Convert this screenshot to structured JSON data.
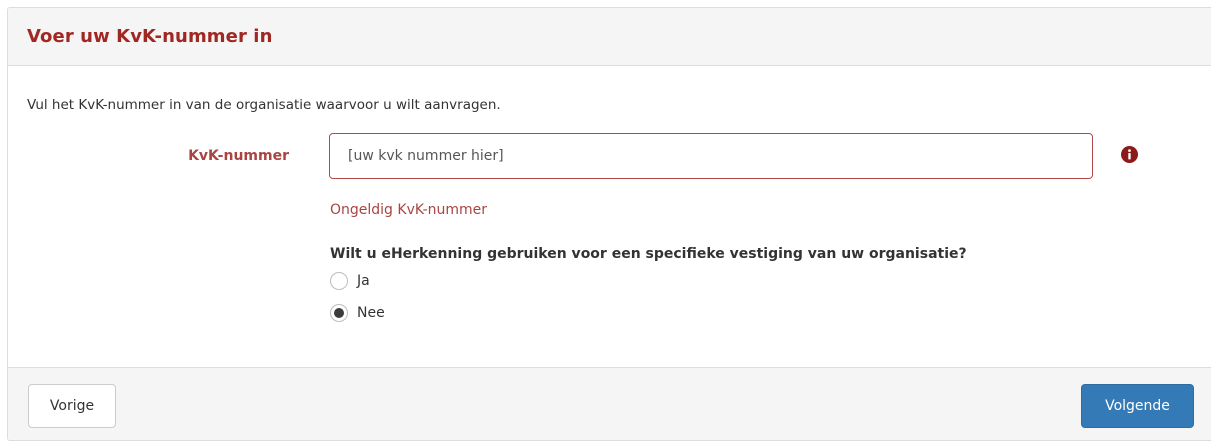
{
  "panel": {
    "title": "Voer uw KvK-nummer in"
  },
  "form": {
    "intro": "Vul het KvK-nummer in van de organisatie waarvoor u wilt aanvragen.",
    "kvk_label": "KvK-nummer",
    "kvk_value": "[uw kvk nummer hier]",
    "error_icon": "exclamation-circle-icon",
    "error_message": "Ongeldig KvK-nummer",
    "question": "Wilt u eHerkenning gebruiken voor een specifieke vestiging van uw organisatie?",
    "options": [
      {
        "label": "Ja",
        "checked": false
      },
      {
        "label": "Nee",
        "checked": true
      }
    ]
  },
  "footer": {
    "prev_label": "Vorige",
    "next_label": "Volgende"
  },
  "colors": {
    "title": "#a02722",
    "error": "#a94442",
    "primary": "#337ab7",
    "panel_bg": "#f5f5f5"
  }
}
